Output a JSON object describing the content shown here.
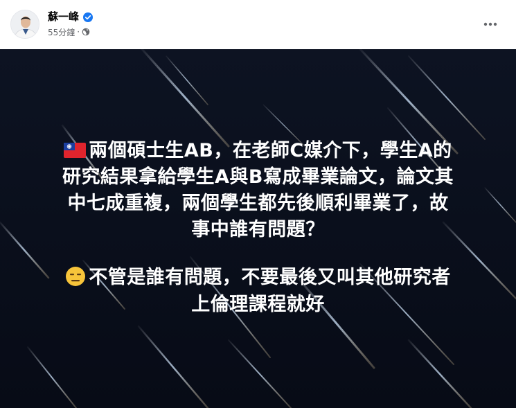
{
  "post": {
    "author": {
      "name": "蘇一峰",
      "verified": true
    },
    "timestamp": "55分鐘",
    "separator": "·",
    "audience_icon": "globe-icon",
    "more_icon": "more-options-icon"
  },
  "image": {
    "background_color": "#0b1120",
    "text_color": "#ffffff",
    "lines": [
      {
        "emoji": "flag-taiwan-icon",
        "text": "兩個碩士生AB，在老師C媒介下，學生A的"
      },
      {
        "text": "研究結果拿給學生A與B寫成畢業論文，論文其"
      },
      {
        "text": "中七成重複，兩個學生都先後順利畢業了，故"
      },
      {
        "text": "事中誰有問題？"
      },
      {
        "emoji": "expressionless-face-icon",
        "text": "不管是誰有問題，不要最後又叫其他研究者"
      },
      {
        "text": "上倫理課程就好"
      }
    ]
  },
  "colors": {
    "name": "#050505",
    "meta": "#65676b",
    "verified": "#1877f2"
  }
}
